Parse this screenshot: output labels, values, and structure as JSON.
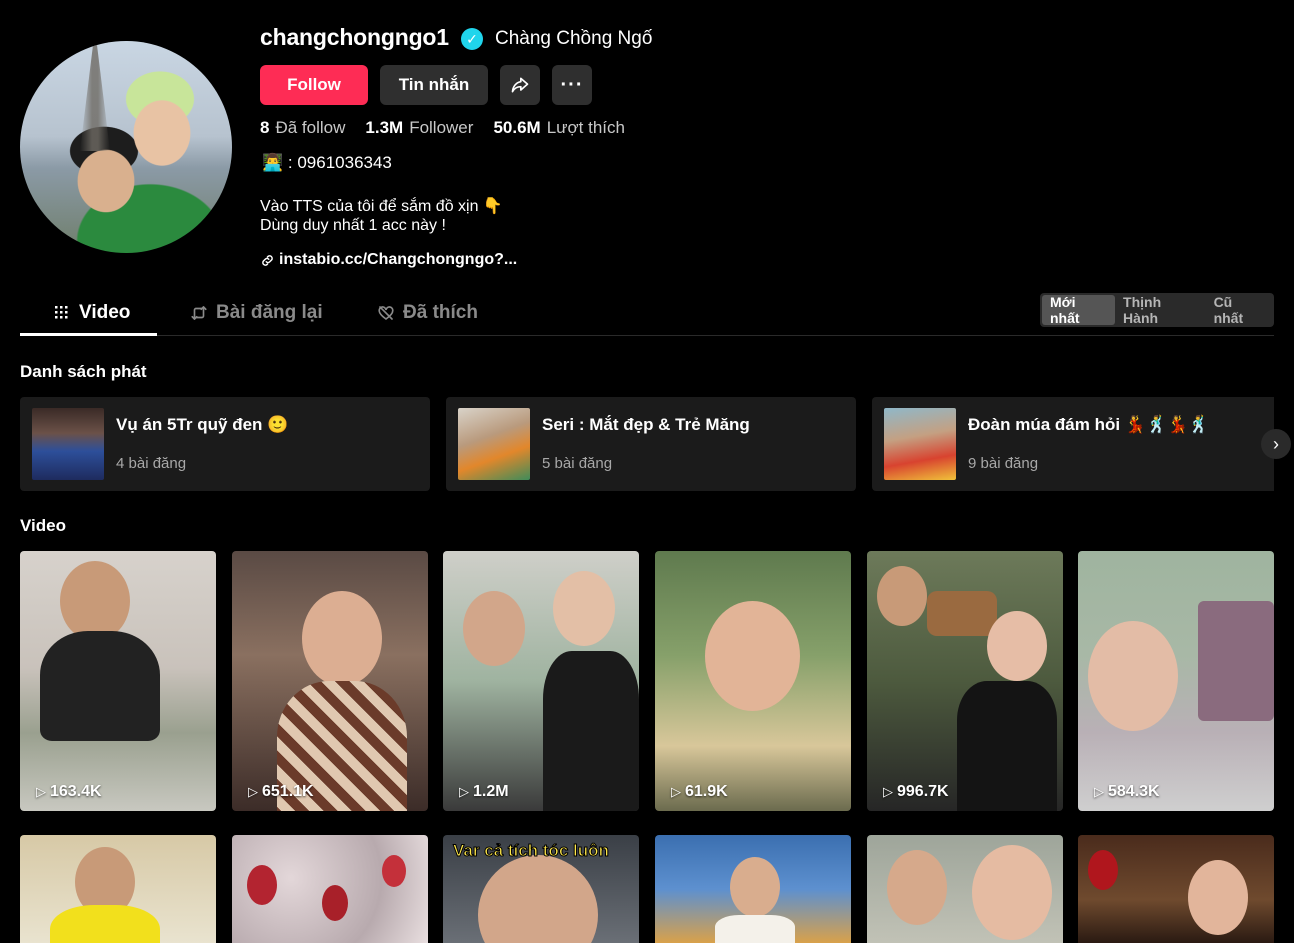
{
  "profile": {
    "username": "changchongngo1",
    "verified_mark": "✓",
    "nickname": "Chàng Chồng Ngố",
    "follow_label": "Follow",
    "message_label": "Tin nhắn",
    "more_label": "···",
    "stats": [
      {
        "value": "8",
        "label": "Đã follow"
      },
      {
        "value": "1.3M",
        "label": "Follower"
      },
      {
        "value": "50.6M",
        "label": "Lượt thích"
      }
    ],
    "phone_line": "👨‍💻 : 0961036343",
    "bio_line1": "Vào TTS của tôi để sắm đồ xịn 👇",
    "bio_line2": "Dùng duy nhất 1 acc này !",
    "link": "instabio.cc/Changchongngo?..."
  },
  "tabs": {
    "video": "Video",
    "reposts": "Bài đăng lại",
    "liked": "Đã thích"
  },
  "sort": [
    "Mới nhất",
    "Thịnh Hành",
    "Cũ nhất"
  ],
  "playlists": {
    "title": "Danh sách phát",
    "items": [
      {
        "name": "Vụ án 5Tr quỹ đen 🙂",
        "count": "4 bài đăng"
      },
      {
        "name": "Seri : Mắt đẹp & Trẻ Măng",
        "count": "5 bài đăng"
      },
      {
        "name": "Đoàn múa đám hỏi 💃🕺💃🕺",
        "count": "9 bài đăng"
      }
    ],
    "next": "›"
  },
  "videos": {
    "title": "Video",
    "play_glyph": "▷",
    "row1": [
      "163.4K",
      "651.1K",
      "1.2M",
      "61.9K",
      "996.7K",
      "584.3K"
    ],
    "row2_caption": "Var cả tích tóc luôn"
  }
}
